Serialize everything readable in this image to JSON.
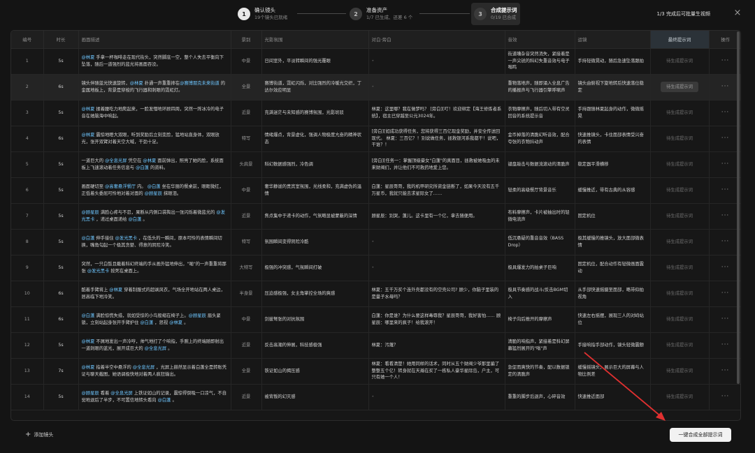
{
  "stepper": {
    "steps": [
      {
        "num": "1",
        "title": "确认镜头",
        "sub": "19个镜头已就绪"
      },
      {
        "num": "2",
        "title": "准备资产",
        "sub": "1/7 已生成、还差 6 个"
      },
      {
        "num": "3",
        "title": "合成提示词",
        "sub": "0/19 已合成"
      }
    ],
    "right_text": "1/3 完成后可批量生视频",
    "close": "×"
  },
  "table": {
    "headers": [
      "编号",
      "时长",
      "画面描述",
      "景别",
      "光影氛围",
      "对白·旁白",
      "音效",
      "运镜",
      "最终提示词",
      "操作"
    ],
    "rows": [
      {
        "idx": "1",
        "dur": "5s",
        "desc": [
          [
            "m",
            "@林夏"
          ],
          [
            "t",
            " 手拿一杯咖啡走在现代街头，突然脚底一空，整个人失去平衡向下坠落，随后一道强烈的蓝光将画面吞没。"
          ]
        ],
        "shot": "中景",
        "light": "日间室外，平淡转瞬间的强光覆眼",
        "dialog": "",
        "sound": "街道嘈杂音突然消失，紧接着是一声尖锐的科幻失重音效与电子嗡鸣",
        "cam": "手持轻微晃动，随后急速坠落跟拍",
        "final": "待生成提示词"
      },
      {
        "idx": "2",
        "dur": "6s",
        "desc": [
          [
            "t",
            "镜头伴随蓝光快速旋转，"
          ],
          [
            "m",
            "@林夏"
          ],
          [
            "t",
            " 扑通一声重重摔在"
          ],
          [
            "m",
            "@赛博朋克未来街道"
          ],
          [
            "t",
            " 的金属地板上，背景是穿梭的飞行器和刺眼的霓虹灯。"
          ]
        ],
        "shot": "全景",
        "light": "赛博街道，霓虹闪烁，对比强烈的冷暖光交织，丁达尔效应明显",
        "dialog": "",
        "sound": "重物落地声，随即涌入全息广告的播报声与飞行器引擎呼啸声",
        "cam": "镜头由俯视下旋地转后快速落位稳定",
        "final": "待生成提示词"
      },
      {
        "idx": "3",
        "dur": "5s",
        "desc": [
          [
            "m",
            "@林夏"
          ],
          [
            "t",
            " 揉着腰吃力地爬起来，一脸发懵地环顾四周，突然一阵冰冷的电子音在她脑海中响起。"
          ]
        ],
        "shot": "近景",
        "light": "充满迷茫与未知感的赛博氛围，光影斑驳",
        "dialog": "林夏：这里哪？我在做梦吗？ [旁白][叮！欢迎绑定【海王修炼者系统】，宿主已穿越至公元3024年。",
        "sound": "衣物摩擦声，随后切入带有空灵回音的系统提示音",
        "cam": "手持跟随林夏起身的动作，微微摇晃",
        "final": "待生成提示词"
      },
      {
        "idx": "4",
        "dur": "6s",
        "desc": [
          [
            "m",
            "@林夏"
          ],
          [
            "t",
            " 震惊地瞪大双眼，听到奖励后立刻变脸，猛地站直身体，双眼放光，张开双臂对着天空大喊，干劲十足。"
          ]
        ],
        "shot": "特写",
        "light": "情绪爆点，背景虚化，强调人物极度亢奋的精神状态",
        "dialog": "[旁白][如成功获得任务，您将获得三百亿现金奖励，并安全传送回现代。 林夏：三百亿？！别说做任务，拯救银河系我都干！说吧，干谁？！",
        "sound": "金币掉落的清脆幻听音效，配合夸张的衣物抖动声",
        "cam": "快速推镜头，卡住面部表情受兴奋的表情",
        "final": "待生成提示词"
      },
      {
        "idx": "5",
        "dur": "5s",
        "desc": [
          [
            "t",
            "一道巨大的 "
          ],
          [
            "m",
            "@全息光屏"
          ],
          [
            "t",
            " 凭空在 "
          ],
          [
            "m",
            "@林夏"
          ],
          [
            "t",
            " 面前弹出，照亮了她的脸，系统面板上飞速滚动着任务信息与 "
          ],
          [
            "m",
            "@白蓬"
          ],
          [
            "t",
            " 的资料。"
          ]
        ],
        "shot": "头肩景",
        "light": "科幻数据感强烈，冷色调",
        "dialog": "[旁白][任务一：掌握顶级豪女\"白蓬\"的真面目，拯救被她吸血的未来财阀们，并让他们不可救药地爱上您。",
        "sound": "键盘敲击与数据流滚动的清脆声",
        "cam": "稳定器平滑横移",
        "final": "待生成提示词"
      },
      {
        "idx": "6",
        "dur": "5s",
        "desc": [
          [
            "t",
            "画面硬切至 "
          ],
          [
            "m",
            "@高奢悬浮餐厅"
          ],
          [
            "t",
            " 内。 "
          ],
          [
            "m",
            "@白蓬"
          ],
          [
            "t",
            " 坐在华丽的餐桌前，眼眶微红，正低着头委屈可怜地对着对面的 "
          ],
          [
            "m",
            "@顾星辰"
          ],
          [
            "t",
            " 抹眼泪。"
          ]
        ],
        "shot": "中景",
        "light": "奢华静谧的贵宾室氛围，光线柔和，充满虚伪的温情",
        "dialog": "白蓬：星辰哥哥，我的机甲研究所资金链断了，如果今天没有五千万星币，我就只能去求星际女了……",
        "sound": "轻柔的高级餐厅背景音乐",
        "cam": "缓慢推近，带有古典的从容感",
        "final": "待生成提示词"
      },
      {
        "idx": "7",
        "dur": "5s",
        "desc": [
          [
            "m",
            "@顾星辰"
          ],
          [
            "t",
            " 满脸心疼与不忍，果断从内侧口袋掏出一张闪烁着微蓝光的 "
          ],
          [
            "m",
            "@发光黑卡"
          ],
          [
            "t",
            " ，递过桌面递给 "
          ],
          [
            "m",
            "@白蓬"
          ],
          [
            "t",
            " 。"
          ]
        ],
        "shot": "近景",
        "light": "焦点集中于递卡的动作，气氛略显被蒙蔽的深情",
        "dialog": "顾星辰：别哭，蓬儿。这卡里有一个亿，拿去随便用。",
        "sound": "布料摩擦声，卡片被抽出时的轻微电流声",
        "cam": "固定机位",
        "final": "待生成提示词"
      },
      {
        "idx": "8",
        "dur": "5s",
        "desc": [
          [
            "m",
            "@白蓬"
          ],
          [
            "t",
            " 伸手接住 "
          ],
          [
            "m",
            "@发光黑卡"
          ],
          [
            "t",
            " ，在低头的一瞬间，原本可怜的表情瞬间切换，嘴角勾起一个极其贪婪、得意的阴险冷笑。"
          ]
        ],
        "shot": "特写",
        "light": "氛围瞬间变得阴险冷酷",
        "dialog": "",
        "sound": "低沉悬疑的重音音效（BASS Drop）",
        "cam": "极其缓慢的推镜头，放大面部微表情",
        "final": "待生成提示词"
      },
      {
        "idx": "9",
        "dur": "5s",
        "desc": [
          [
            "t",
            "突然，一只白皙且戴着科幻终端的手从画外猛地伸出，\"啪\"的一声重重将那张 "
          ],
          [
            "m",
            "@发光黑卡"
          ],
          [
            "t",
            " 按死在桌面上。"
          ]
        ],
        "shot": "大特写",
        "light": "极强的冲突感，气氛瞬间打破",
        "dialog": "",
        "sound": "极具爆发力的拍桌子巨响",
        "cam": "固定机位，配合动作有轻微画面震动",
        "final": "待生成提示词"
      },
      {
        "idx": "10",
        "dur": "6s",
        "desc": [
          [
            "t",
            "酷着手臂将上 "
          ],
          [
            "m",
            "@林夏"
          ],
          [
            "t",
            " 穿着制服式的超飒风衣，气场全开地站在两人桌边，居高临下地冷笑。"
          ]
        ],
        "shot": "半身景",
        "light": "压迫感极强，女主角掌控全场的爽感",
        "dialog": "林夏：五千万买个连外壳都没有的空壳公司? 顾少，你脑子里装的是量子水母吗？",
        "sound": "极具节奏感的战斗/反击BGM切入",
        "cam": "从手部快速摇摄至面部，略带仰拍视角",
        "final": "待生成提示词"
      },
      {
        "idx": "11",
        "dur": "6s",
        "desc": [
          [
            "m",
            "@白蓬"
          ],
          [
            "t",
            " 满脸惊慌失措，就如受惊的小鸟般缩在椅子上。"
          ],
          [
            "m",
            "@顾星辰"
          ],
          [
            "t",
            " 眉头紧锁，立刻站起身张开手臂护住 "
          ],
          [
            "m",
            "@白蓬"
          ],
          [
            "t",
            " ，怒视 "
          ],
          [
            "m",
            "@林夏"
          ],
          [
            "t",
            " 。"
          ]
        ],
        "shot": "中景",
        "light": "剑拔弩张的对抗氛围",
        "dialog": "白蓬：你是谁？为什么要这样毒辱我？星辰哥哥，我好害怕…… 顾星辰：哪里来的疯子！给我滚开！",
        "sound": "椅子向后推开的摩擦声",
        "cam": "快速左右摇摆，展现三人的对峙站位",
        "final": "待生成提示词"
      },
      {
        "idx": "12",
        "dur": "5s",
        "desc": [
          [
            "m",
            "@林夏"
          ],
          [
            "t",
            " 不屑地发出一声冷哼，帅气地打了个响指，手腕上的终端随即射出一道刺眼的蓝光，展开成巨大的 "
          ],
          [
            "m",
            "@全息光屏"
          ],
          [
            "t",
            " 。"
          ]
        ],
        "shot": "近景",
        "light": "反击高潮的伸展，科技感极强",
        "dialog": "林夏：污蔑？",
        "sound": "清脆的响指声，紧接着是科幻屏幕猛烈展开的\"嗡\"声",
        "cam": "手接响指手部动作，镜头轻微震颤",
        "final": "待生成提示词"
      },
      {
        "idx": "13",
        "dur": "7s",
        "desc": [
          [
            "m",
            "@林夏"
          ],
          [
            "t",
            " 指着半空中悬浮的 "
          ],
          [
            "m",
            "@全息光屏"
          ],
          [
            "t",
            " ，光屏上赫然显示着白蓬全是转账凭证与聊天截图，她语调极快地对着两人疯狂输出。"
          ]
        ],
        "shot": "全景",
        "light": "铁证如山的揭压感",
        "dialog": "林夏：看看清楚！她用同样的话术，同时从五个财阀少爷那里骗了整整五个亿！转身就在天瀚在买了一栋私人豪华星际岛，户主，可只有她一个人！",
        "sound": "急促而爽快的节奏，配以数据锁定的清脆声",
        "cam": "缓慢摇镜头，展示巨大的屏幕与人物比例差",
        "final": "待生成提示词"
      },
      {
        "idx": "14",
        "dur": "5s",
        "desc": [
          [
            "m",
            "@顾星辰"
          ],
          [
            "t",
            " 看着 "
          ],
          [
            "m",
            "@全息光屏"
          ],
          [
            "t",
            " 上铁证如山的记录，震惊得倒吸一口凉气，不自觉地退后了半步，不可置信地转头看向 "
          ],
          [
            "m",
            "@白蓬"
          ],
          [
            "t",
            " 。"
          ]
        ],
        "shot": "近景",
        "light": "被背叛的幻灭感",
        "dialog": "",
        "sound": "重重的脚步后退声，心碎音效",
        "cam": "快速推近面部",
        "final": "待生成提示词"
      }
    ]
  },
  "bottom": {
    "add_shot_label": "添加镜头",
    "generate_all_label": "一键合成全部提示词"
  }
}
